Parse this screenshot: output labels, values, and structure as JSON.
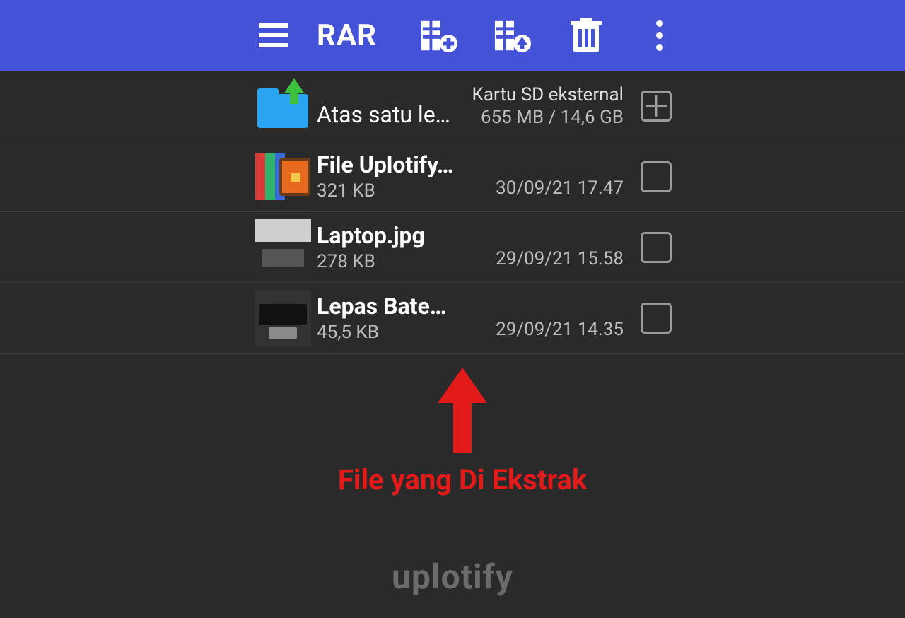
{
  "appbar": {
    "title": "RAR"
  },
  "nav_row": {
    "label": "Atas satu level",
    "storage_label": "Kartu SD eksternal",
    "storage_usage": "655 MB / 14,6 GB"
  },
  "files": [
    {
      "name": "File Uplotify.rar",
      "size": "321 KB",
      "date": "30/09/21 17.47",
      "type": "rar"
    },
    {
      "name": "Laptop.jpg",
      "size": "278 KB",
      "date": "29/09/21 15.58",
      "type": "image-laptop"
    },
    {
      "name": "Lepas Baterai Laptop.jpg",
      "size": "45,5 KB",
      "date": "29/09/21 14.35",
      "type": "image-battery"
    }
  ],
  "annotation": {
    "label": "File yang Di Ekstrak"
  },
  "watermark": "uplotify",
  "colors": {
    "appbar": "#4452d8",
    "background": "#2a2a2a",
    "annotation": "#e21a1a"
  }
}
